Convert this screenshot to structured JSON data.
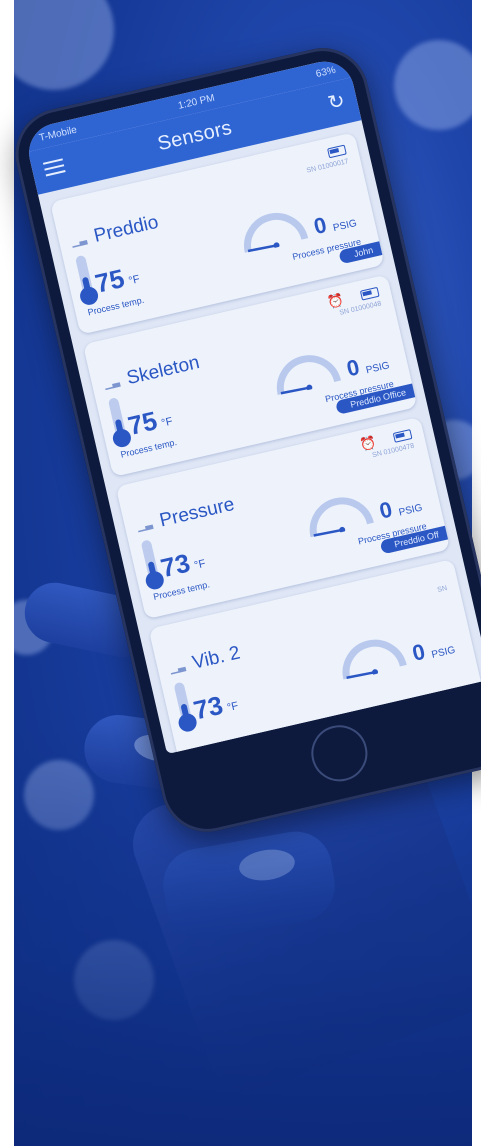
{
  "status_bar": {
    "carrier": "T-Mobile",
    "time": "1:20 PM",
    "battery": "63%"
  },
  "nav": {
    "title": "Sensors",
    "menu_icon": "menu-icon",
    "refresh_icon": "refresh-icon"
  },
  "sensors": [
    {
      "name": "Preddio",
      "serial": "SN 01000017",
      "temp": "75",
      "temp_unit": "°F",
      "temp_label": "Process temp.",
      "pressure": "0",
      "pressure_unit": "PSIG",
      "pressure_label": "Process pressure",
      "tag": "John",
      "alarm": false
    },
    {
      "name": "Skeleton",
      "serial": "SN 01000048",
      "temp": "75",
      "temp_unit": "°F",
      "temp_label": "Process temp.",
      "pressure": "0",
      "pressure_unit": "PSIG",
      "pressure_label": "Process pressure",
      "tag": "Preddio Office",
      "alarm": true
    },
    {
      "name": "Pressure",
      "serial": "SN 01000478",
      "temp": "73",
      "temp_unit": "°F",
      "temp_label": "Process temp.",
      "pressure": "0",
      "pressure_unit": "PSIG",
      "pressure_label": "Process pressure",
      "tag": "Preddio Off",
      "alarm": true
    },
    {
      "name": "Vib. 2",
      "serial": "SN",
      "temp": "73",
      "temp_unit": "°F",
      "temp_label": "",
      "pressure": "0",
      "pressure_unit": "PSIG",
      "pressure_label": "",
      "tag": "",
      "alarm": false
    }
  ],
  "colors": {
    "brand_blue": "#2b57c4",
    "background": "#1f46ab"
  }
}
